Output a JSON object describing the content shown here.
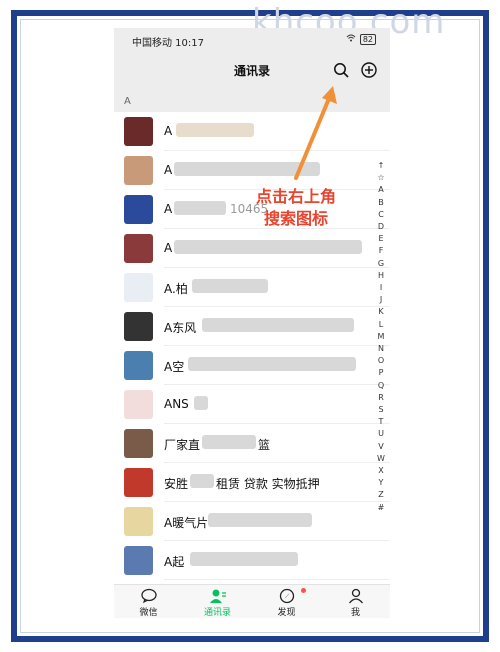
{
  "watermark": "khcoo.com",
  "status_bar": {
    "carrier_time": "中国移动 10:17",
    "battery": "82"
  },
  "nav": {
    "title": "通讯录",
    "search_icon": "search-icon",
    "add_icon": "plus-circle-icon"
  },
  "section_letter": "A",
  "contacts": [
    {
      "name": "A",
      "avatar_color": "#6a2a2a"
    },
    {
      "name": "A",
      "avatar_color": "#c89a7a"
    },
    {
      "name": "A",
      "suffix": "10465",
      "avatar_color": "#2b4a9c"
    },
    {
      "name": "A",
      "avatar_color": "#8a3a3a"
    },
    {
      "name": "A.柏",
      "avatar_color": "#e9eef4"
    },
    {
      "name": "A东风",
      "avatar_color": "#333333"
    },
    {
      "name": "A空",
      "avatar_color": "#4a7fb0"
    },
    {
      "name": "ANS",
      "avatar_color": "#f2dcdc"
    },
    {
      "name": "厂家直",
      "suffix": "篮",
      "avatar_color": "#7a5a48"
    },
    {
      "name": "安胜",
      "suffix": "租赁 贷款 实物抵押",
      "avatar_color": "#c0392b"
    },
    {
      "name": "A暖气片",
      "avatar_color": "#e8d6a0"
    },
    {
      "name": "A起",
      "avatar_color": "#5a7ab0"
    }
  ],
  "index_letters": [
    "↑",
    "☆",
    "A",
    "B",
    "C",
    "D",
    "E",
    "F",
    "G",
    "H",
    "I",
    "J",
    "K",
    "L",
    "M",
    "N",
    "O",
    "P",
    "Q",
    "R",
    "S",
    "T",
    "U",
    "V",
    "W",
    "X",
    "Y",
    "Z",
    "#"
  ],
  "tabs": [
    {
      "label": "微信",
      "icon": "chat-bubble-icon"
    },
    {
      "label": "通讯录",
      "icon": "contacts-icon"
    },
    {
      "label": "发现",
      "icon": "compass-icon"
    },
    {
      "label": "我",
      "icon": "person-icon"
    }
  ],
  "annotation": {
    "line1": "点击右上角",
    "line2": "搜索图标"
  },
  "colors": {
    "frame": "#1f3f8c",
    "accent_green": "#07c160",
    "annotation": "#e8442e",
    "arrow": "#f0913a"
  }
}
